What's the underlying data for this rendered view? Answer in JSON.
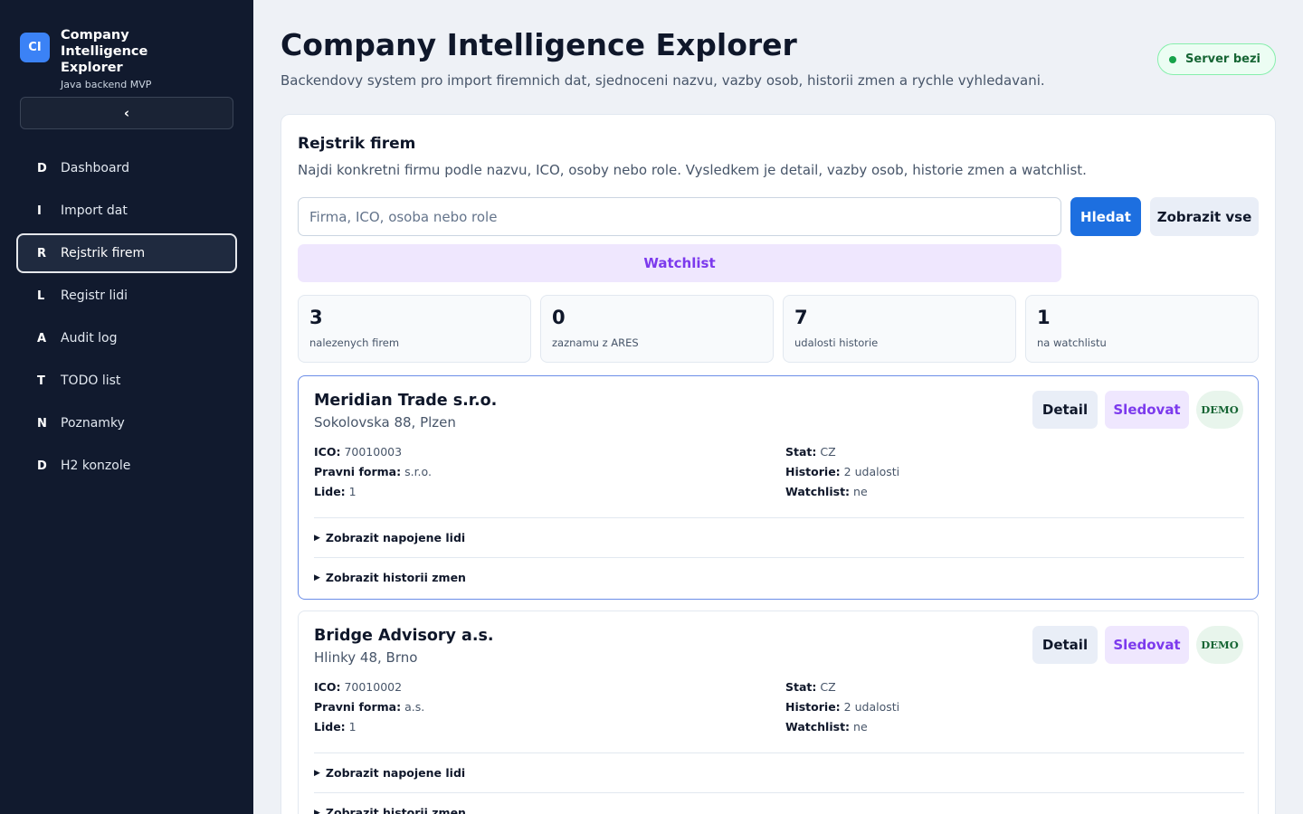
{
  "brand": {
    "logo": "CI",
    "title": "Company Intelligence Explorer",
    "subtitle": "Java backend MVP"
  },
  "sidebar": {
    "collapse_label": "‹",
    "items": [
      {
        "letter": "D",
        "label": "Dashboard"
      },
      {
        "letter": "I",
        "label": "Import dat"
      },
      {
        "letter": "R",
        "label": "Rejstrik firem",
        "active": true
      },
      {
        "letter": "L",
        "label": "Registr lidi"
      },
      {
        "letter": "A",
        "label": "Audit log"
      },
      {
        "letter": "T",
        "label": "TODO list"
      },
      {
        "letter": "N",
        "label": "Poznamky"
      },
      {
        "letter": "D",
        "label": "H2 konzole"
      }
    ]
  },
  "header": {
    "title": "Company Intelligence Explorer",
    "subtitle": "Backendovy system pro import firemnich dat, sjednoceni nazvu, vazby osob, historii zmen a rychle vyhledavani.",
    "server_status": "Server bezi"
  },
  "registry": {
    "title": "Rejstrik firem",
    "subtitle": "Najdi konkretni firmu podle nazvu, ICO, osoby nebo role. Vysledkem je detail, vazby osob, historie zmen a watchlist.",
    "search_placeholder": "Firma, ICO, osoba nebo role",
    "search_value": "",
    "search_button": "Hledat",
    "show_all_button": "Zobrazit vse",
    "watchlist_button": "Watchlist"
  },
  "stats": [
    {
      "value": "3",
      "label": "nalezenych firem"
    },
    {
      "value": "0",
      "label": "zaznamu z ARES"
    },
    {
      "value": "7",
      "label": "udalosti historie"
    },
    {
      "value": "1",
      "label": "na watchlistu"
    }
  ],
  "labels": {
    "ico": "ICO:",
    "legal_form": "Pravni forma:",
    "people": "Lide:",
    "country": "Stat:",
    "history": "Historie:",
    "watchlist": "Watchlist:",
    "detail_button": "Detail",
    "follow_button": "Sledovat",
    "demo_badge": "DEMO",
    "show_people": "Zobrazit napojene lidi",
    "show_history": "Zobrazit historii zmen"
  },
  "companies": [
    {
      "name": "Meridian Trade s.r.o.",
      "address": "Sokolovska 88, Plzen",
      "ico": "70010003",
      "legal_form": "s.r.o.",
      "people": "1",
      "country": "CZ",
      "history": "2 udalosti",
      "watchlist": "ne"
    },
    {
      "name": "Bridge Advisory a.s.",
      "address": "Hlinky 48, Brno",
      "ico": "70010002",
      "legal_form": "a.s.",
      "people": "1",
      "country": "CZ",
      "history": "2 udalosti",
      "watchlist": "ne"
    }
  ],
  "colors": {
    "sidebar_bg": "#111a2e",
    "primary": "#1d6fe0",
    "accent_purple": "#7c3aed",
    "success": "#16a34a"
  }
}
